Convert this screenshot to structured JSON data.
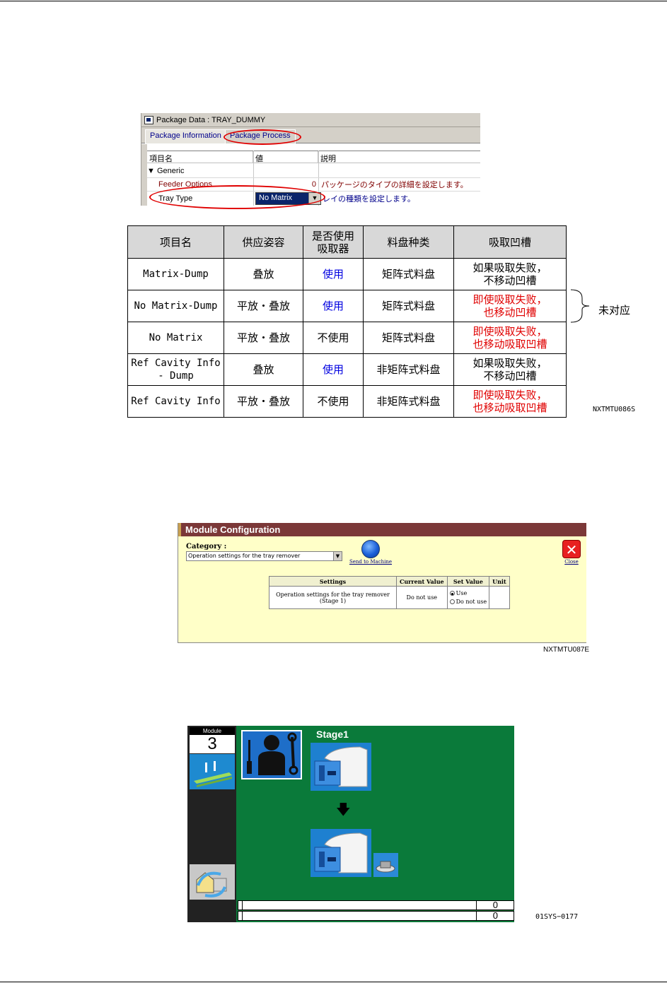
{
  "package_window": {
    "title": "Package Data : TRAY_DUMMY",
    "tabs": [
      "Package Information",
      "Package Process"
    ],
    "columns": [
      "項目名",
      "値",
      "説明"
    ],
    "group": "▼ Generic",
    "rows": [
      {
        "name": "Feeder Options",
        "value": "0",
        "desc": "パッケージのタイプの詳細を設定します。"
      },
      {
        "name": "Tray Type",
        "value": "No Matrix",
        "desc": "レイの種類を設定します。"
      }
    ]
  },
  "cn_table": {
    "headers": [
      "项目名",
      "供应姿容",
      "是否使用\n吸取器",
      "料盘种类",
      "吸取凹槽"
    ],
    "rows": [
      {
        "name": "Matrix-Dump",
        "posture": "叠放",
        "use": "使用",
        "use_color": "blue",
        "tray": "矩阵式料盘",
        "cavity": "如果吸取失败，\n不移动凹槽",
        "cavity_color": "black"
      },
      {
        "name": "No Matrix-Dump",
        "posture": "平放・叠放",
        "use": "使用",
        "use_color": "blue",
        "tray": "矩阵式料盘",
        "cavity": "即使吸取失败，\n也移动凹槽",
        "cavity_color": "red"
      },
      {
        "name": "No Matrix",
        "posture": "平放・叠放",
        "use": "不使用",
        "use_color": "black",
        "tray": "矩阵式料盘",
        "cavity": "即使吸取失败，\n也移动吸取凹槽",
        "cavity_color": "red"
      },
      {
        "name": "Ref Cavity Info\n- Dump",
        "posture": "叠放",
        "use": "使用",
        "use_color": "blue",
        "tray": "非矩阵式料盘",
        "cavity": "如果吸取失败，\n不移动凹槽",
        "cavity_color": "black"
      },
      {
        "name": "Ref Cavity Info",
        "posture": "平放・叠放",
        "use": "不使用",
        "use_color": "black",
        "tray": "非矩阵式料盘",
        "cavity": "即使吸取失败，\n也移动吸取凹槽",
        "cavity_color": "red"
      }
    ],
    "brace_label": "未对应",
    "figure_code": "NXTMTU086S"
  },
  "module_config": {
    "title": "Module Configuration",
    "category_label": "Category :",
    "category_value": "Operation settings for the tray remover",
    "send_label": "Send to Machine",
    "close_label": "Close",
    "columns": [
      "Settings",
      "Current Value",
      "Set Value",
      "Unit"
    ],
    "row": {
      "setting": "Operation settings for the tray remover (Stage 1)",
      "current": "Do not use",
      "options": [
        "Use",
        "Do not use"
      ],
      "selected": "Use",
      "unit": ""
    },
    "figure_code": "NXTMTU087E"
  },
  "machine_screen": {
    "module_label": "Module",
    "module_number": "3",
    "stage_label": "Stage1",
    "arrow": "🡇",
    "counters": [
      "0",
      "0"
    ],
    "figure_code": "01SYS−0177"
  },
  "colors": {
    "red": "#e00000",
    "blue": "#0000e0",
    "mc_bar": "#7b3838",
    "screen_green": "#0a7a3a"
  }
}
